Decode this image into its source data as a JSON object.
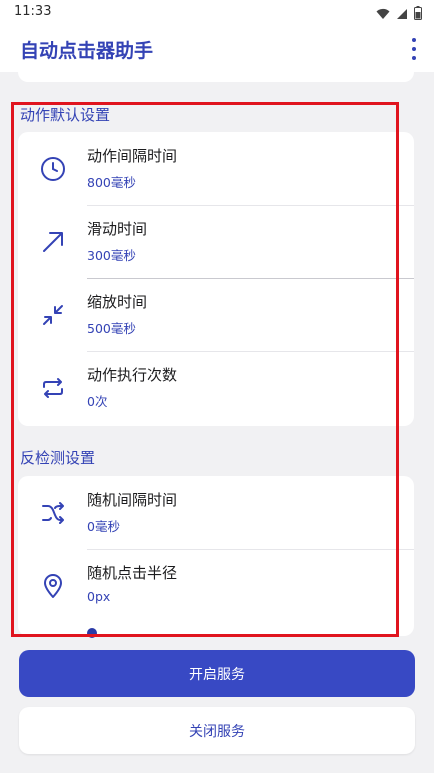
{
  "status_bar": {
    "time": "11:33",
    "icons": [
      "wifi-icon",
      "signal-icon",
      "battery-icon"
    ]
  },
  "app_bar": {
    "title": "自动点击器助手",
    "menu_icon": "more-vert-icon"
  },
  "sections": [
    {
      "header": "动作默认设置",
      "items": [
        {
          "title": "动作间隔时间",
          "value": "800毫秒",
          "icon": "clock-icon"
        },
        {
          "title": "滑动时间",
          "value": "300毫秒",
          "icon": "arrow-up-right-icon"
        },
        {
          "title": "缩放时间",
          "value": "500毫秒",
          "icon": "zoom-in-icon"
        },
        {
          "title": "动作执行次数",
          "value": "0次",
          "icon": "repeat-icon"
        }
      ]
    },
    {
      "header": "反检测设置",
      "items": [
        {
          "title": "随机间隔时间",
          "value": "0毫秒",
          "icon": "shuffle-icon"
        },
        {
          "title": "随机点击半径",
          "value": "0px",
          "icon": "location-pin-icon"
        }
      ]
    }
  ],
  "buttons": {
    "start_service": "开启服务",
    "stop_service": "关闭服务"
  },
  "colors": {
    "accent": "#3443b5",
    "primary_button": "#3849c4",
    "highlight": "#e0141e",
    "background": "#f1f1f3"
  }
}
